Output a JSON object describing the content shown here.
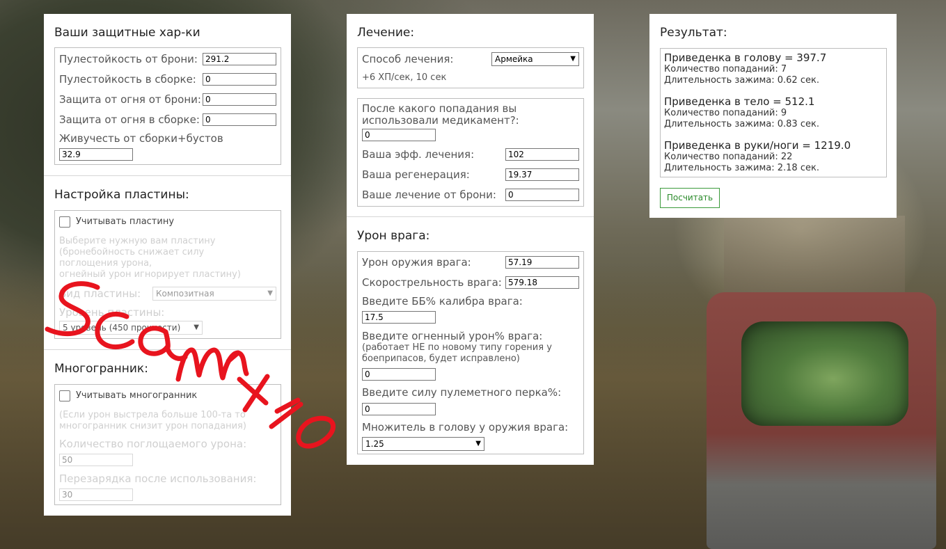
{
  "defense": {
    "title": "Ваши защитные хар-ки",
    "fields": [
      {
        "label": "Пулестойкость от брони:",
        "value": "291.2"
      },
      {
        "label": "Пулестойкость в сборке:",
        "value": "0"
      },
      {
        "label": "Защита от огня от брони:",
        "value": "0"
      },
      {
        "label": "Защита от огня в сборке:",
        "value": "0"
      },
      {
        "label": "Живучесть от сборки+бустов",
        "value": "32.9"
      }
    ]
  },
  "plate": {
    "title": "Настройка пластины:",
    "checkbox_label": "Учитывать пластину",
    "note": [
      "Выберите нужную вам пластину",
      "(бронебойность снижает силу",
      "поглощения урона,",
      "огнейный урон игнорирует пластину)"
    ],
    "type_label": "Вид пластины:",
    "type_value": "Композитная",
    "level_label": "Уровень пластины:",
    "level_value": "5 уровень (450 прочности)"
  },
  "poly": {
    "title": "Многогранник:",
    "checkbox_label": "Учитывать многогранник",
    "note": [
      "(Если урон выстрела больше 100-та то",
      "многогранник снизит урон попадания)"
    ],
    "absorb_label": "Количество поглощаемого урона:",
    "absorb_value": "50",
    "cooldown_label": "Перезарядка после использования:",
    "cooldown_value": "30"
  },
  "healing": {
    "title": "Лечение:",
    "method_label": "Способ лечения:",
    "method_value": "Армейка",
    "method_note": "+6 ХП/сек, 10 сек",
    "after_hit_label": [
      "После какого попадания вы",
      "использовали медикамент?:"
    ],
    "after_hit_value": "0",
    "eff_label": "Ваша эфф. лечения:",
    "eff_value": "102",
    "regen_label": "Ваша регенерация:",
    "regen_value": "19.37",
    "armor_heal_label": "Ваше лечение от брони:",
    "armor_heal_value": "0"
  },
  "enemy": {
    "title": "Урон врага:",
    "damage_label": "Урон оружия врага:",
    "damage_value": "57.19",
    "rate_label": "Скорострельность врага:",
    "rate_value": "579.18",
    "bb_label": "Введите ББ% калибра врага:",
    "bb_value": "17.5",
    "fire_label": "Введите огненный урон% врага:",
    "fire_note": [
      "(работает НЕ по новому типу горения у",
      "боеприпасов, будет исправлено)"
    ],
    "fire_value": "0",
    "perk_label": "Введите силу пулеметного перка%:",
    "perk_value": "0",
    "head_mult_label": "Множитель в голову у оружия врага:",
    "head_mult_value": "1.25"
  },
  "result": {
    "title": "Результат:",
    "blocks": [
      {
        "head": "Приведенка в голову = 397.7",
        "hits": "Количество попаданий: 7",
        "duration": "Длительность зажима: 0.62 сек."
      },
      {
        "head": "Приведенка в тело = 512.1",
        "hits": "Количество попаданий: 9",
        "duration": "Длительность зажима: 0.83 сек."
      },
      {
        "head": "Приведенка в руки/ноги = 1219.0",
        "hits": "Количество попаданий: 22",
        "duration": "Длительность зажима: 2.18 сек."
      }
    ],
    "button": "Посчитать"
  },
  "colors": {
    "button_green": "#2a8a2a",
    "scribble_red": "#e8141e"
  },
  "icons": {
    "select_arrow": "chevron-down-icon",
    "checkbox": "checkbox-icon"
  }
}
